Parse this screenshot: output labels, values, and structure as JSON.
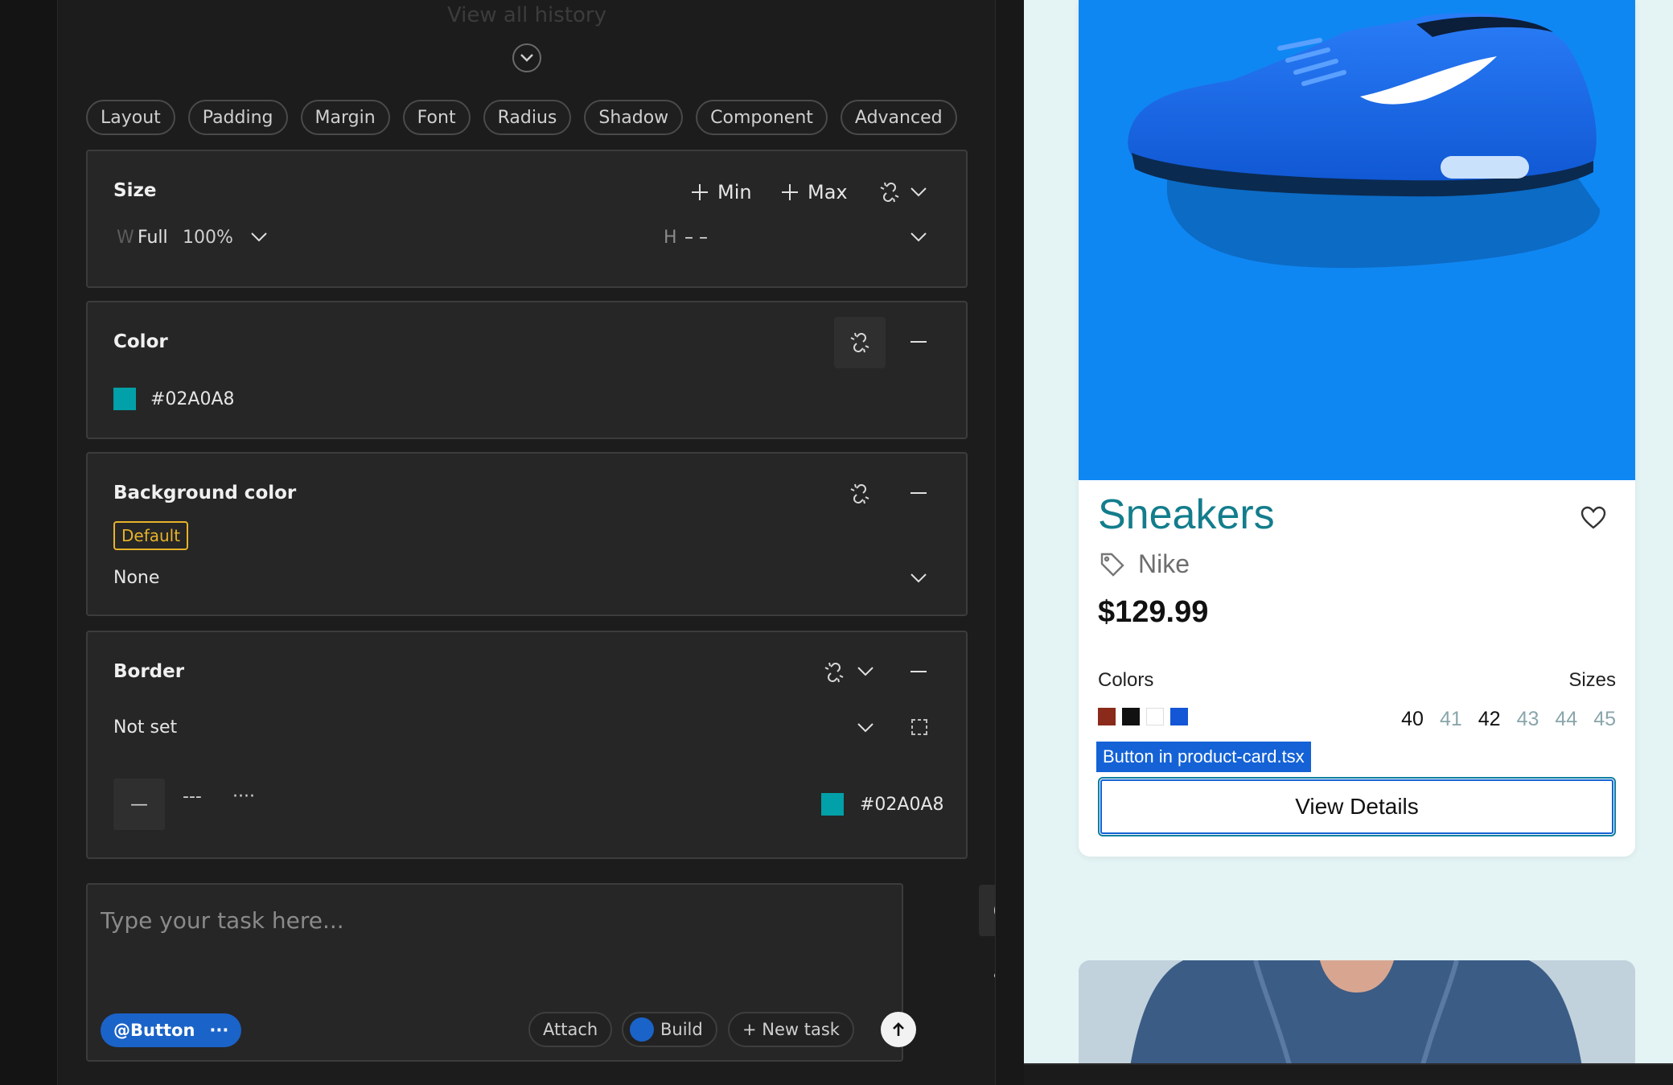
{
  "history": {
    "label": "View all history"
  },
  "tabs": [
    "Layout",
    "Padding",
    "Margin",
    "Font",
    "Radius",
    "Shadow",
    "Component",
    "Advanced"
  ],
  "size": {
    "title": "Size",
    "min_label": "Min",
    "max_label": "Max",
    "w_prefix": "W",
    "w_mode": "Full",
    "w_value": "100%",
    "h_prefix": "H",
    "h_value": "– –"
  },
  "color": {
    "title": "Color",
    "value": "#02A0A8",
    "swatch": "#02A0A8"
  },
  "background": {
    "title": "Background color",
    "badge": "Default",
    "value": "None"
  },
  "border": {
    "title": "Border",
    "value": "Not set",
    "style_solid": "—",
    "style_dashed": "---",
    "style_dotted": "····",
    "color_value": "#02A0A8",
    "color_swatch": "#02A0A8"
  },
  "task": {
    "placeholder": "Type your task here...",
    "mention": "@Button",
    "mention_more": "···",
    "attach": "Attach",
    "build": "Build",
    "new_task": "+ New task"
  },
  "product": {
    "title": "Sneakers",
    "brand": "Nike",
    "price": "$129.99",
    "colors_label": "Colors",
    "sizes_label": "Sizes",
    "colors": [
      "#8a2a1a",
      "#111111",
      "#ffffff",
      "#1356d6"
    ],
    "sizes": [
      {
        "label": "40",
        "available": true
      },
      {
        "label": "41",
        "available": false
      },
      {
        "label": "42",
        "available": true
      },
      {
        "label": "43",
        "available": false
      },
      {
        "label": "44",
        "available": false
      },
      {
        "label": "45",
        "available": false
      }
    ],
    "selection_badge": "Button in product-card.tsx",
    "cta": "View Details"
  },
  "theme": {
    "accent": "#1a63c8",
    "badge_yellow": "#e7b32a",
    "product_bg": "#0f87f3",
    "title_teal": "#137d8c"
  }
}
